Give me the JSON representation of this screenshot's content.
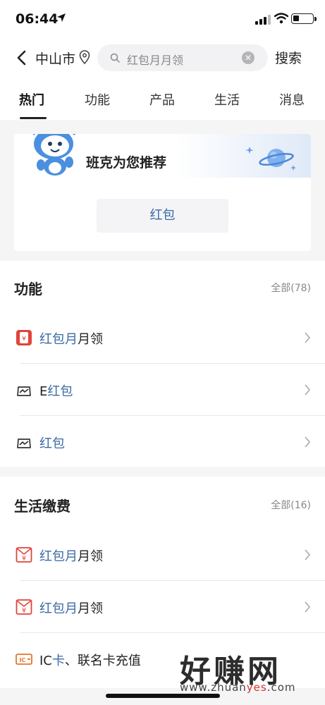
{
  "status_bar": {
    "time": "06:44"
  },
  "search_bar": {
    "city": "中山市",
    "query": "红包月月领",
    "search_label": "搜索"
  },
  "tabs": [
    "热门",
    "功能",
    "产品",
    "生活",
    "消息"
  ],
  "recommend": {
    "title": "班克为您推荐",
    "chip": "红包"
  },
  "features": {
    "title": "功能",
    "all": "全部(78)",
    "items": [
      {
        "hl": "红包月",
        "rest": "月领",
        "icon": "red-envelope-icon"
      },
      {
        "pre": "E",
        "hl": "红包",
        "icon": "tray-chart-icon"
      },
      {
        "hl": "红包",
        "icon": "tray-chart-icon"
      }
    ]
  },
  "life": {
    "title": "生活缴费",
    "all": "全部(16)",
    "items": [
      {
        "hl": "红包月",
        "rest": "月领",
        "icon": "yuan-envelope-icon"
      },
      {
        "hl": "红包月",
        "rest": "月领",
        "icon": "yuan-envelope-icon"
      },
      {
        "pre": "IC",
        "hl": "卡",
        "rest": "、联名卡充值",
        "icon": "ic-card-icon"
      }
    ]
  },
  "watermark": {
    "big": "好赚网",
    "domain_pre": "www.zhuan",
    "domain_hl": "yes",
    "domain_post": ".com"
  },
  "colors": {
    "highlight": "#3a6aa5",
    "accent_red": "#e0443c",
    "ic_orange": "#e8742b"
  }
}
